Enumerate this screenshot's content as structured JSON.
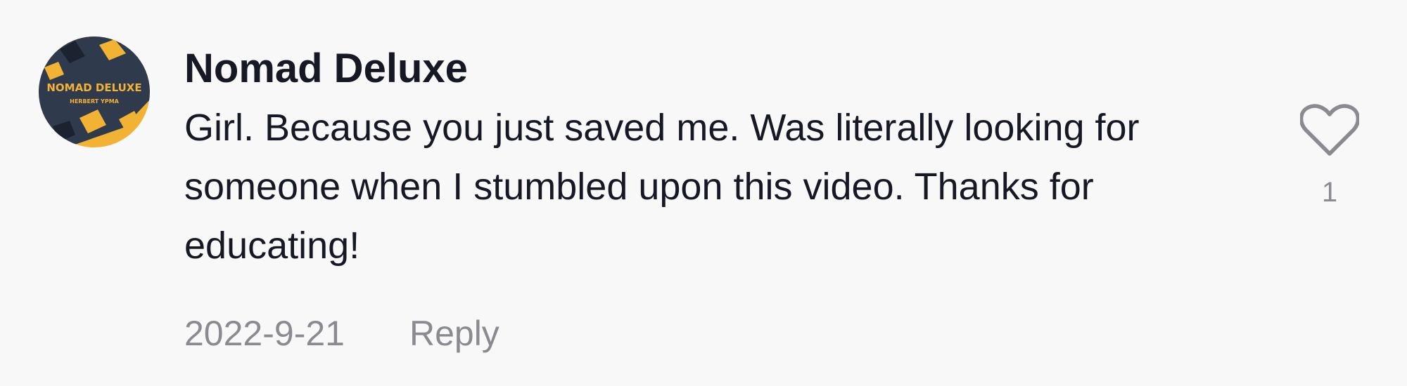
{
  "comment": {
    "username": "Nomad Deluxe",
    "text": "Girl. Because you just saved me. Was literally looking for someone when I stumbled upon this video. Thanks for educating!",
    "date": "2022-9-21",
    "reply_label": "Reply",
    "like_count": "1",
    "avatar": {
      "line1": "NOMAD DELUXE",
      "line2": "HERBERT YPMA"
    }
  },
  "icons": {
    "like": "heart-outline-icon"
  },
  "colors": {
    "background": "#f8f8f8",
    "primary_text": "#161823",
    "secondary_text": "#8a8b91",
    "avatar_yellow": "#f2b233",
    "avatar_dark": "#2f3b4c"
  }
}
